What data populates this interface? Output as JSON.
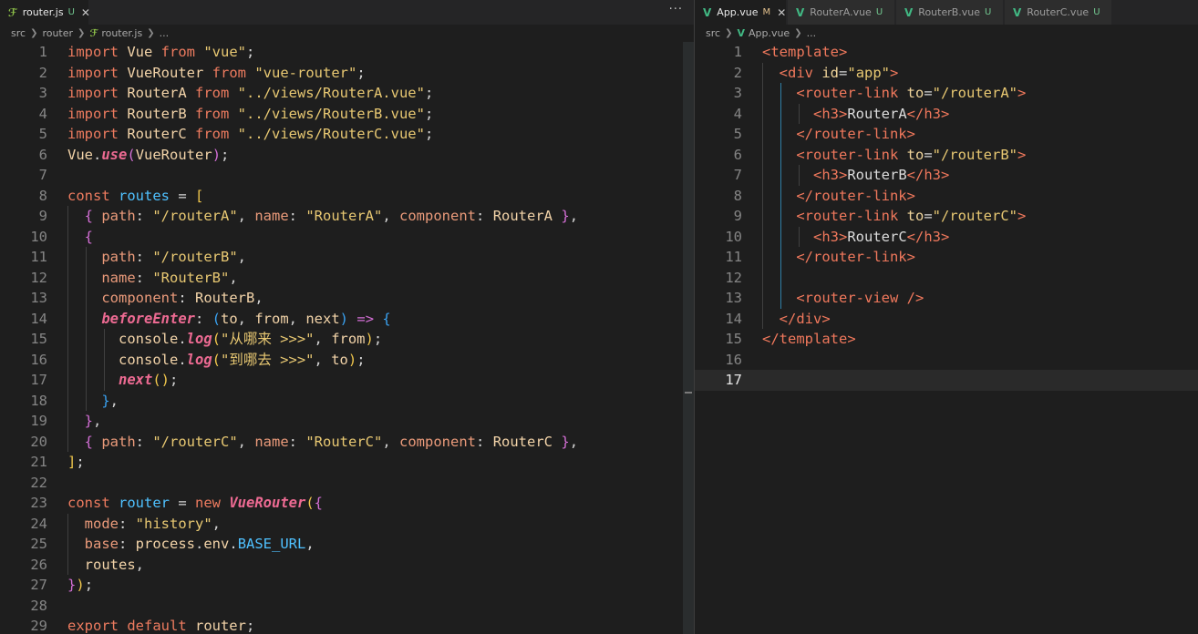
{
  "left": {
    "tabs": [
      {
        "label": "router.js",
        "icon": "js-file-icon",
        "status": "U",
        "active": true
      }
    ],
    "more_actions": "···",
    "breadcrumb": [
      "src",
      "router",
      "router.js",
      "..."
    ],
    "line_numbers": [
      "1",
      "2",
      "3",
      "4",
      "5",
      "6",
      "7",
      "8",
      "9",
      "10",
      "11",
      "12",
      "13",
      "14",
      "15",
      "16",
      "17",
      "18",
      "19",
      "20",
      "21",
      "22",
      "23",
      "24",
      "25",
      "26",
      "27",
      "28",
      "29"
    ]
  },
  "right": {
    "tabs": [
      {
        "label": "App.vue",
        "icon": "vue-file-icon",
        "status": "M",
        "active": true
      },
      {
        "label": "RouterA.vue",
        "icon": "vue-file-icon",
        "status": "U",
        "active": false
      },
      {
        "label": "RouterB.vue",
        "icon": "vue-file-icon",
        "status": "U",
        "active": false
      },
      {
        "label": "RouterC.vue",
        "icon": "vue-file-icon",
        "status": "U",
        "active": false
      }
    ],
    "breadcrumb": [
      "src",
      "App.vue",
      "..."
    ],
    "line_numbers": [
      "1",
      "2",
      "3",
      "4",
      "5",
      "6",
      "7",
      "8",
      "9",
      "10",
      "11",
      "12",
      "13",
      "14",
      "15",
      "16",
      "17"
    ],
    "current_line": "17"
  },
  "colors": {
    "background": "#1e1e1e",
    "tab_bar": "#252526",
    "keyword": "#ed7b5f",
    "string": "#e8c872",
    "tag": "#f0785c",
    "function": "#ec6a92"
  },
  "left_code": [
    [
      [
        "kw",
        "import "
      ],
      [
        "id",
        "Vue "
      ],
      [
        "kw",
        "from "
      ],
      [
        "str",
        "\"vue\""
      ],
      [
        "pu",
        ";"
      ]
    ],
    [
      [
        "kw",
        "import "
      ],
      [
        "id",
        "VueRouter "
      ],
      [
        "kw",
        "from "
      ],
      [
        "str",
        "\"vue-router\""
      ],
      [
        "pu",
        ";"
      ]
    ],
    [
      [
        "kw",
        "import "
      ],
      [
        "id",
        "RouterA "
      ],
      [
        "kw",
        "from "
      ],
      [
        "str",
        "\"../views/RouterA.vue\""
      ],
      [
        "pu",
        ";"
      ]
    ],
    [
      [
        "kw",
        "import "
      ],
      [
        "id",
        "RouterB "
      ],
      [
        "kw",
        "from "
      ],
      [
        "str",
        "\"../views/RouterB.vue\""
      ],
      [
        "pu",
        ";"
      ]
    ],
    [
      [
        "kw",
        "import "
      ],
      [
        "id",
        "RouterC "
      ],
      [
        "kw",
        "from "
      ],
      [
        "str",
        "\"../views/RouterC.vue\""
      ],
      [
        "pu",
        ";"
      ]
    ],
    [
      [
        "id",
        "Vue"
      ],
      [
        "pu",
        "."
      ],
      [
        "fn",
        "use"
      ],
      [
        "b2",
        "("
      ],
      [
        "id",
        "VueRouter"
      ],
      [
        "b2",
        ")"
      ],
      [
        "pu",
        ";"
      ]
    ],
    [],
    [
      [
        "kw",
        "const "
      ],
      [
        "blue",
        "routes "
      ],
      [
        "pu",
        "= "
      ],
      [
        "b1",
        "["
      ]
    ],
    [
      [
        "pu",
        "  "
      ],
      [
        "b2",
        "{ "
      ],
      [
        "prop",
        "path"
      ],
      [
        "pu",
        ": "
      ],
      [
        "str",
        "\"/routerA\""
      ],
      [
        "pu",
        ", "
      ],
      [
        "prop",
        "name"
      ],
      [
        "pu",
        ": "
      ],
      [
        "str",
        "\"RouterA\""
      ],
      [
        "pu",
        ", "
      ],
      [
        "prop",
        "component"
      ],
      [
        "pu",
        ": "
      ],
      [
        "id",
        "RouterA "
      ],
      [
        "b2",
        "}"
      ],
      [
        "pu",
        ","
      ]
    ],
    [
      [
        "pu",
        "  "
      ],
      [
        "b2",
        "{"
      ]
    ],
    [
      [
        "pu",
        "    "
      ],
      [
        "prop",
        "path"
      ],
      [
        "pu",
        ": "
      ],
      [
        "str",
        "\"/routerB\""
      ],
      [
        "pu",
        ","
      ]
    ],
    [
      [
        "pu",
        "    "
      ],
      [
        "prop",
        "name"
      ],
      [
        "pu",
        ": "
      ],
      [
        "str",
        "\"RouterB\""
      ],
      [
        "pu",
        ","
      ]
    ],
    [
      [
        "pu",
        "    "
      ],
      [
        "prop",
        "component"
      ],
      [
        "pu",
        ": "
      ],
      [
        "id",
        "RouterB"
      ],
      [
        "pu",
        ","
      ]
    ],
    [
      [
        "pu",
        "    "
      ],
      [
        "fn",
        "beforeEnter"
      ],
      [
        "pu",
        ": "
      ],
      [
        "b3",
        "("
      ],
      [
        "id",
        "to"
      ],
      [
        "pu",
        ", "
      ],
      [
        "id",
        "from"
      ],
      [
        "pu",
        ", "
      ],
      [
        "id",
        "next"
      ],
      [
        "b3",
        ")"
      ],
      [
        "pu",
        " "
      ],
      [
        "b2",
        "=>"
      ],
      [
        "pu",
        " "
      ],
      [
        "b3",
        "{"
      ]
    ],
    [
      [
        "pu",
        "      "
      ],
      [
        "id",
        "console"
      ],
      [
        "pu",
        "."
      ],
      [
        "fn",
        "log"
      ],
      [
        "b1",
        "("
      ],
      [
        "str",
        "\"从哪来 >>>\""
      ],
      [
        "pu",
        ", "
      ],
      [
        "id",
        "from"
      ],
      [
        "b1",
        ")"
      ],
      [
        "pu",
        ";"
      ]
    ],
    [
      [
        "pu",
        "      "
      ],
      [
        "id",
        "console"
      ],
      [
        "pu",
        "."
      ],
      [
        "fn",
        "log"
      ],
      [
        "b1",
        "("
      ],
      [
        "str",
        "\"到哪去 >>>\""
      ],
      [
        "pu",
        ", "
      ],
      [
        "id",
        "to"
      ],
      [
        "b1",
        ")"
      ],
      [
        "pu",
        ";"
      ]
    ],
    [
      [
        "pu",
        "      "
      ],
      [
        "fn",
        "next"
      ],
      [
        "b1",
        "()"
      ],
      [
        "pu",
        ";"
      ]
    ],
    [
      [
        "pu",
        "    "
      ],
      [
        "b3",
        "}"
      ],
      [
        "pu",
        ","
      ]
    ],
    [
      [
        "pu",
        "  "
      ],
      [
        "b2",
        "}"
      ],
      [
        "pu",
        ","
      ]
    ],
    [
      [
        "pu",
        "  "
      ],
      [
        "b2",
        "{ "
      ],
      [
        "prop",
        "path"
      ],
      [
        "pu",
        ": "
      ],
      [
        "str",
        "\"/routerC\""
      ],
      [
        "pu",
        ", "
      ],
      [
        "prop",
        "name"
      ],
      [
        "pu",
        ": "
      ],
      [
        "str",
        "\"RouterC\""
      ],
      [
        "pu",
        ", "
      ],
      [
        "prop",
        "component"
      ],
      [
        "pu",
        ": "
      ],
      [
        "id",
        "RouterC "
      ],
      [
        "b2",
        "}"
      ],
      [
        "pu",
        ","
      ]
    ],
    [
      [
        "b1",
        "]"
      ],
      [
        "pu",
        ";"
      ]
    ],
    [],
    [
      [
        "kw",
        "const "
      ],
      [
        "blue",
        "router "
      ],
      [
        "pu",
        "= "
      ],
      [
        "kw",
        "new "
      ],
      [
        "fn",
        "VueRouter"
      ],
      [
        "b1",
        "("
      ],
      [
        "b2",
        "{"
      ]
    ],
    [
      [
        "pu",
        "  "
      ],
      [
        "prop",
        "mode"
      ],
      [
        "pu",
        ": "
      ],
      [
        "str",
        "\"history\""
      ],
      [
        "pu",
        ","
      ]
    ],
    [
      [
        "pu",
        "  "
      ],
      [
        "prop",
        "base"
      ],
      [
        "pu",
        ": "
      ],
      [
        "id",
        "process"
      ],
      [
        "pu",
        "."
      ],
      [
        "id",
        "env"
      ],
      [
        "pu",
        "."
      ],
      [
        "blue",
        "BASE_URL"
      ],
      [
        "pu",
        ","
      ]
    ],
    [
      [
        "pu",
        "  "
      ],
      [
        "id",
        "routes"
      ],
      [
        "pu",
        ","
      ]
    ],
    [
      [
        "b2",
        "}"
      ],
      [
        "b1",
        ")"
      ],
      [
        "pu",
        ";"
      ]
    ],
    [],
    [
      [
        "kw",
        "export "
      ],
      [
        "kw",
        "default "
      ],
      [
        "id",
        "router"
      ],
      [
        "pu",
        ";"
      ]
    ]
  ],
  "right_code": [
    [
      [
        "tag",
        "<template>"
      ]
    ],
    [
      [
        "pu",
        "  "
      ],
      [
        "tag",
        "<div "
      ],
      [
        "attr",
        "id"
      ],
      [
        "pu",
        "="
      ],
      [
        "str",
        "\"app\""
      ],
      [
        "tag",
        ">"
      ]
    ],
    [
      [
        "pu",
        "    "
      ],
      [
        "tag",
        "<router-link "
      ],
      [
        "attr",
        "to"
      ],
      [
        "pu",
        "="
      ],
      [
        "str",
        "\"/routerA\""
      ],
      [
        "tag",
        ">"
      ]
    ],
    [
      [
        "pu",
        "      "
      ],
      [
        "tag",
        "<h3>"
      ],
      [
        "txt",
        "RouterA"
      ],
      [
        "tag",
        "</h3>"
      ]
    ],
    [
      [
        "pu",
        "    "
      ],
      [
        "tag",
        "</router-link>"
      ]
    ],
    [
      [
        "pu",
        "    "
      ],
      [
        "tag",
        "<router-link "
      ],
      [
        "attr",
        "to"
      ],
      [
        "pu",
        "="
      ],
      [
        "str",
        "\"/routerB\""
      ],
      [
        "tag",
        ">"
      ]
    ],
    [
      [
        "pu",
        "      "
      ],
      [
        "tag",
        "<h3>"
      ],
      [
        "txt",
        "RouterB"
      ],
      [
        "tag",
        "</h3>"
      ]
    ],
    [
      [
        "pu",
        "    "
      ],
      [
        "tag",
        "</router-link>"
      ]
    ],
    [
      [
        "pu",
        "    "
      ],
      [
        "tag",
        "<router-link "
      ],
      [
        "attr",
        "to"
      ],
      [
        "pu",
        "="
      ],
      [
        "str",
        "\"/routerC\""
      ],
      [
        "tag",
        ">"
      ]
    ],
    [
      [
        "pu",
        "      "
      ],
      [
        "tag",
        "<h3>"
      ],
      [
        "txt",
        "RouterC"
      ],
      [
        "tag",
        "</h3>"
      ]
    ],
    [
      [
        "pu",
        "    "
      ],
      [
        "tag",
        "</router-link>"
      ]
    ],
    [],
    [
      [
        "pu",
        "    "
      ],
      [
        "tag",
        "<router-view />"
      ]
    ],
    [
      [
        "pu",
        "  "
      ],
      [
        "tag",
        "</div>"
      ]
    ],
    [
      [
        "tag",
        "</template>"
      ]
    ],
    [],
    []
  ]
}
